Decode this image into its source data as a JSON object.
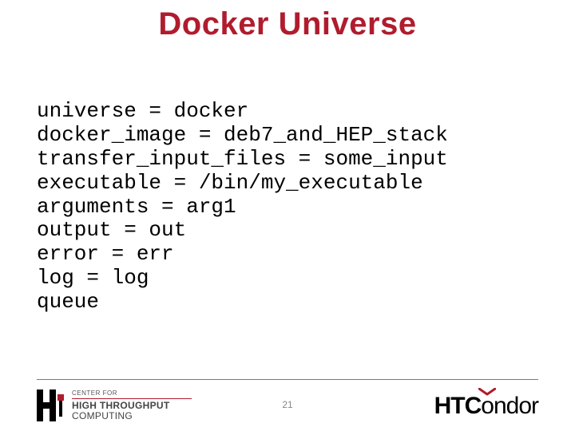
{
  "title": "Docker Universe",
  "code_lines": [
    "universe = docker",
    "docker_image = deb7_and_HEP_stack",
    "transfer_input_files = some_input",
    "executable = /bin/my_executable",
    "arguments = arg1",
    "output = out",
    "error = err",
    "log = log",
    "queue"
  ],
  "page_number": "21",
  "logo_left": {
    "line1": "CENTER FOR",
    "line2": "HIGH THROUGHPUT",
    "line3": "COMPUTING"
  },
  "logo_right": {
    "part1": "HTC",
    "part2_o": "o",
    "part3": "nd",
    "part4_o": "o",
    "part5": "r"
  }
}
